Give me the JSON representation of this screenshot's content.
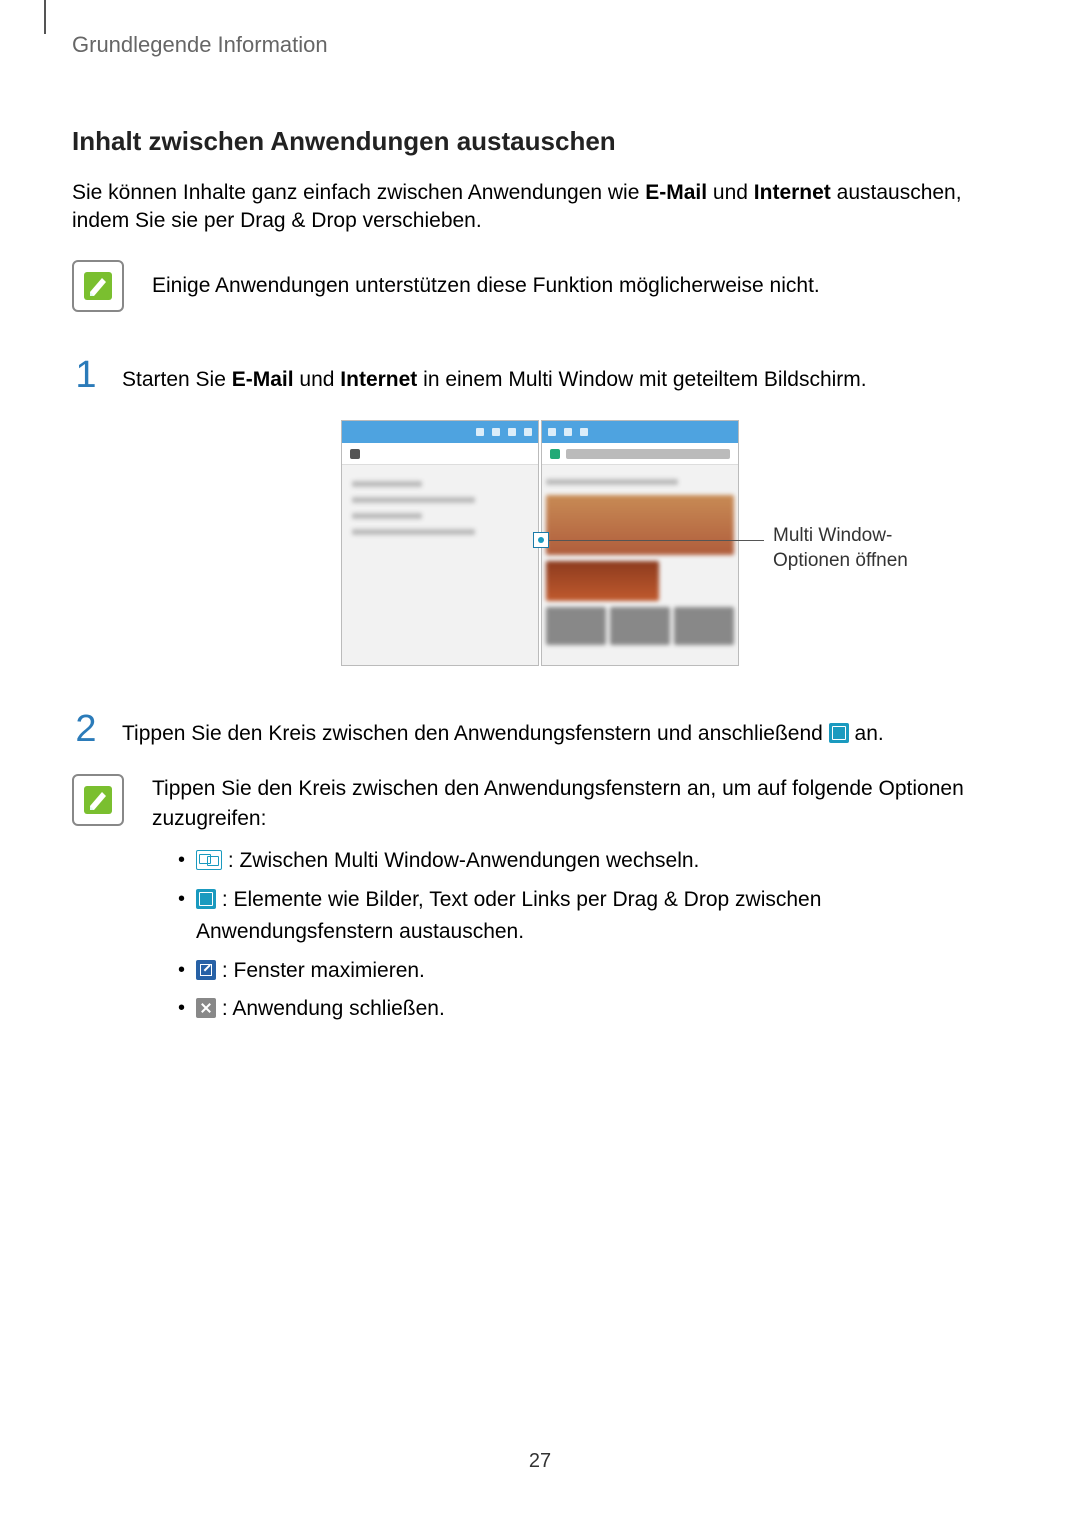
{
  "breadcrumb": "Grundlegende Information",
  "section_title": "Inhalt zwischen Anwendungen austauschen",
  "intro": {
    "p1_a": "Sie können Inhalte ganz einfach zwischen Anwendungen wie ",
    "p1_b": "E-Mail",
    "p1_c": " und ",
    "p1_d": "Internet",
    "p1_e": " austauschen, indem Sie sie per Drag & Drop verschieben."
  },
  "note1": "Einige Anwendungen unterstützen diese Funktion möglicherweise nicht.",
  "step1": {
    "num": "1",
    "a": "Starten Sie ",
    "b": "E-Mail",
    "c": " und ",
    "d": "Internet",
    "e": " in einem Multi Window mit geteiltem Bildschirm."
  },
  "figure": {
    "callout_l1": "Multi Window-",
    "callout_l2": "Optionen öffnen"
  },
  "step2": {
    "num": "2",
    "a": "Tippen Sie den Kreis zwischen den Anwendungsfenstern und anschließend ",
    "b": " an."
  },
  "options": {
    "intro": "Tippen Sie den Kreis zwischen den Anwendungsfenstern an, um auf folgende Optionen zuzugreifen:",
    "items": [
      {
        "text": " : Zwischen Multi Window-Anwendungen wechseln."
      },
      {
        "text": " : Elemente wie Bilder, Text oder Links per Drag & Drop zwischen Anwendungsfenstern austauschen."
      },
      {
        "text": " : Fenster maximieren."
      },
      {
        "text": " : Anwendung schließen."
      }
    ]
  },
  "page_number": "27"
}
